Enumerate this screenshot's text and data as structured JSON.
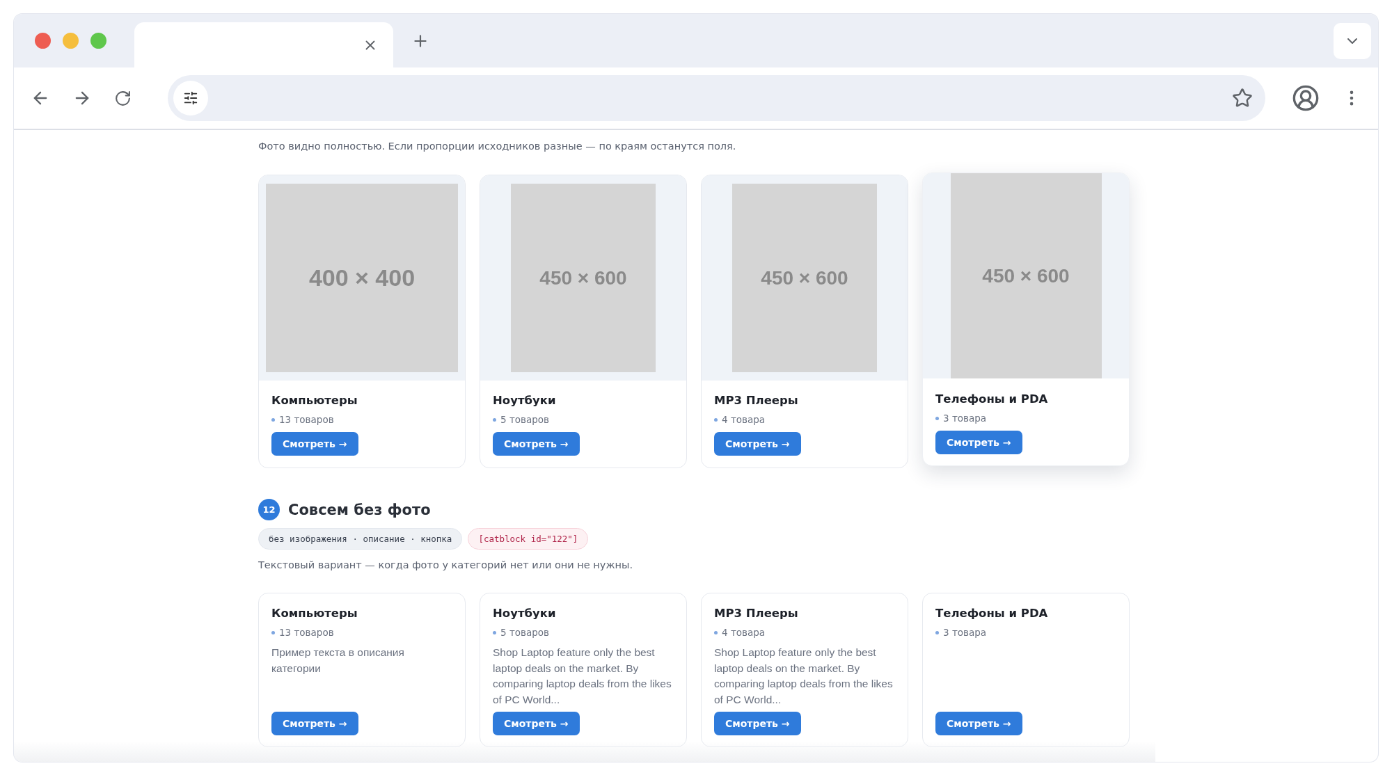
{
  "sections": [
    {
      "kind": "photos",
      "subtitle": "Фото видно полностью. Если пропорции исходников разные — по краям останутся поля.",
      "cards": [
        {
          "title": "Компьютеры",
          "count": "13 товаров",
          "image": {
            "label": "400 × 400",
            "kind": "square"
          },
          "button": "Смотреть →",
          "hovered": false
        },
        {
          "title": "Ноутбуки",
          "count": "5 товаров",
          "image": {
            "label": "450 × 600",
            "kind": "portrait"
          },
          "button": "Смотреть →",
          "hovered": false
        },
        {
          "title": "MP3 Плееры",
          "count": "4 товара",
          "image": {
            "label": "450 × 600",
            "kind": "portrait"
          },
          "button": "Смотреть →",
          "hovered": false
        },
        {
          "title": "Телефоны и PDA",
          "count": "3 товара",
          "image": {
            "label": "450 × 600",
            "kind": "portrait"
          },
          "button": "Смотреть →",
          "hovered": true
        }
      ]
    },
    {
      "kind": "text",
      "number": "12",
      "heading": "Совсем без фото",
      "tags": [
        {
          "text": "без изображения · описание · кнопка",
          "kind": "plain"
        },
        {
          "text": "[catblock id=\"122\"]",
          "kind": "code"
        }
      ],
      "subtitle": "Текстовый вариант — когда фото у категорий нет или они не нужны.",
      "cards": [
        {
          "title": "Компьютеры",
          "count": "13 товаров",
          "description": "Пример текста в описания категории",
          "button": "Смотреть →",
          "hovered": false
        },
        {
          "title": "Ноутбуки",
          "count": "5 товаров",
          "description": "Shop Laptop feature only the best laptop deals on the market. By comparing laptop deals from the likes of PC World...",
          "button": "Смотреть →",
          "hovered": false
        },
        {
          "title": "MP3 Плееры",
          "count": "4 товара",
          "description": "Shop Laptop feature only the best laptop deals on the market. By comparing laptop deals from the likes of PC World...",
          "button": "Смотреть →",
          "hovered": false
        },
        {
          "title": "Телефоны и PDA",
          "count": "3 товара",
          "button": "Смотреть →",
          "hovered": false
        }
      ]
    }
  ]
}
